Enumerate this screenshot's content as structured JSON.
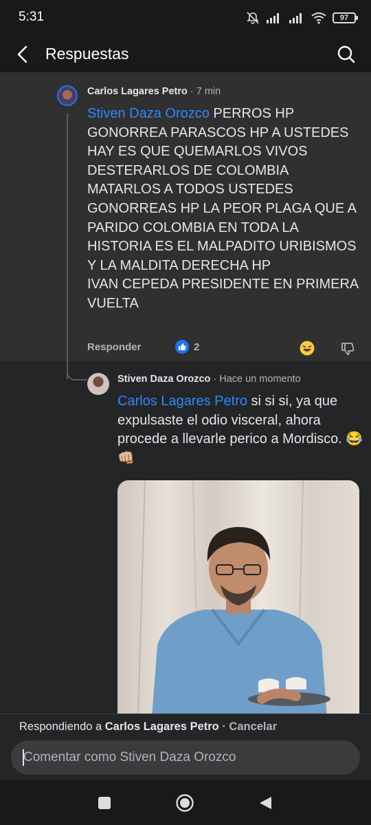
{
  "status_bar": {
    "time": "5:31",
    "battery": "97"
  },
  "app_bar": {
    "title": "Respuestas"
  },
  "parent_comment": {
    "author": "Carlos Lagares Petro",
    "time": "· 7 min",
    "mention": "Stiven Daza Orozco",
    "text": " PERROS HP GONORREA PARASCOS HP A USTEDES HAY ES QUE QUEMARLOS VIVOS DESTERARLOS DE COLOMBIA MATARLOS A TODOS USTEDES GONORREAS HP LA PEOR PLAGA QUE A PARIDO COLOMBIA EN TODA LA HISTORIA ES EL MALPADITO URIBISMOS Y LA MALDITA DERECHA HP\nIVAN CEPEDA PRESIDENTE EN PRIMERA VUELTA",
    "reply_label": "Responder",
    "like_count": "2"
  },
  "reply_comment": {
    "author": "Stiven Daza Orozco",
    "time": "· Hace un momento",
    "mention": "Carlos Lagares Petro",
    "text": " si si si, ya que expulsaste el odio visceral, ahora procede a llevarle perico a Mordisco. 😂 👊🏼"
  },
  "composer": {
    "replying_prefix": "Respondiendo a ",
    "replying_to": "Carlos Lagares Petro",
    "cancel": " · Cancelar",
    "placeholder": "Comentar como Stiven Daza Orozco"
  },
  "colors": {
    "accent": "#1877f2",
    "mention": "#2d88ff",
    "background": "#242526",
    "highlight": "#303031"
  },
  "icons": [
    "back-arrow-icon",
    "search-icon",
    "like-icon",
    "laugh-reaction-icon",
    "dislike-icon",
    "nav-recents-icon",
    "nav-home-icon",
    "nav-back-icon"
  ]
}
